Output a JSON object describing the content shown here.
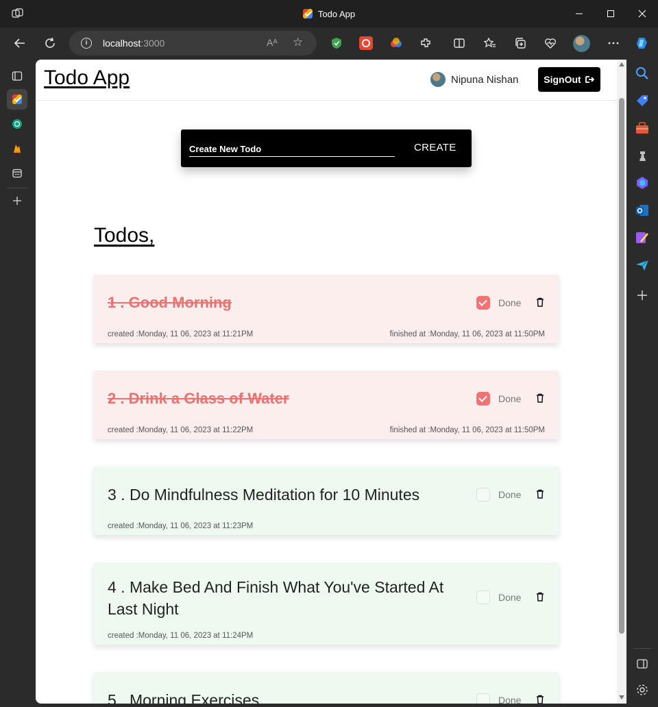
{
  "window": {
    "title": "Todo App"
  },
  "browser": {
    "url_host": "localhost",
    "url_port": ":3000",
    "reader_label": "Aᴬ"
  },
  "app": {
    "brand": "Todo App",
    "user_name": "Nipuna Nishan",
    "signout_label": "SignOut",
    "create": {
      "placeholder": "Create New Todo",
      "button_label": "CREATE"
    },
    "todos_heading": "Todos,",
    "done_label": "Done",
    "todos": [
      {
        "title": "1 . Good Morning",
        "completed": true,
        "created": "created :Monday, 11 06, 2023 at 11:21PM",
        "finished": "finished at :Monday, 11 06, 2023 at 11:50PM"
      },
      {
        "title": "2 . Drink a Glass of Water",
        "completed": true,
        "created": "created :Monday, 11 06, 2023 at 11:22PM",
        "finished": "finished at :Monday, 11 06, 2023 at 11:50PM"
      },
      {
        "title": "3 . Do Mindfulness Meditation for 10 Minutes",
        "completed": false,
        "created": "created :Monday, 11 06, 2023 at 11:23PM"
      },
      {
        "title": "4 . Make Bed And Finish What You've Started At Last Night",
        "completed": false,
        "created": "created :Monday, 11 06, 2023 at 11:24PM"
      },
      {
        "title": "5 . Morning Exercises",
        "completed": false
      }
    ]
  },
  "colors": {
    "done_bg": "#fdeeee",
    "pending_bg": "#eefaf0",
    "done_text": "#f07070",
    "check": "#f27373"
  }
}
